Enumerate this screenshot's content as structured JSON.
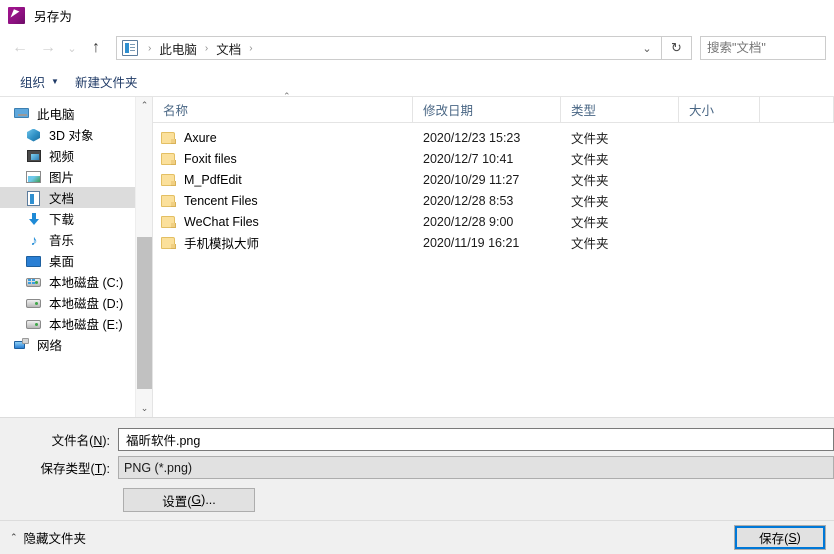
{
  "window": {
    "title": "另存为",
    "app_icon": "foxit-app-icon"
  },
  "nav": {
    "back": "←",
    "forward": "→",
    "recent": "⌄",
    "up": "↑",
    "breadcrumb": [
      "此电脑",
      "文档"
    ],
    "breadcrumb_separator": "›",
    "address_dropdown": "⌄",
    "refresh": "↻"
  },
  "search": {
    "value": "",
    "placeholder": "搜索\"文档\""
  },
  "toolbar": {
    "organize_label": "组织",
    "organize_caret": "▼",
    "new_folder_label": "新建文件夹"
  },
  "sidebar": {
    "items": [
      {
        "label": "此电脑",
        "icon": "pc-icon",
        "indent": false,
        "selected": false
      },
      {
        "label": "3D 对象",
        "icon": "3d-objects-icon",
        "indent": true,
        "selected": false
      },
      {
        "label": "视频",
        "icon": "videos-icon",
        "indent": true,
        "selected": false
      },
      {
        "label": "图片",
        "icon": "pictures-icon",
        "indent": true,
        "selected": false
      },
      {
        "label": "文档",
        "icon": "documents-icon",
        "indent": true,
        "selected": true
      },
      {
        "label": "下载",
        "icon": "downloads-icon",
        "indent": true,
        "selected": false
      },
      {
        "label": "音乐",
        "icon": "music-icon",
        "indent": true,
        "selected": false
      },
      {
        "label": "桌面",
        "icon": "desktop-icon",
        "indent": true,
        "selected": false
      },
      {
        "label": "本地磁盘 (C:)",
        "icon": "drive-system-icon",
        "indent": true,
        "selected": false
      },
      {
        "label": "本地磁盘 (D:)",
        "icon": "drive-icon",
        "indent": true,
        "selected": false
      },
      {
        "label": "本地磁盘 (E:)",
        "icon": "drive-icon",
        "indent": true,
        "selected": false
      },
      {
        "label": "网络",
        "icon": "network-icon",
        "indent": false,
        "selected": false
      }
    ],
    "scroll_up": "⌃",
    "scroll_down": "⌄"
  },
  "filelist": {
    "columns": [
      {
        "label": "名称"
      },
      {
        "label": "修改日期"
      },
      {
        "label": "类型"
      },
      {
        "label": "大小"
      }
    ],
    "sort_indicator": "⌃",
    "rows": [
      {
        "name": "Axure",
        "date": "2020/12/23 15:23",
        "type": "文件夹",
        "size": ""
      },
      {
        "name": "Foxit files",
        "date": "2020/12/7 10:41",
        "type": "文件夹",
        "size": ""
      },
      {
        "name": "M_PdfEdit",
        "date": "2020/10/29 11:27",
        "type": "文件夹",
        "size": ""
      },
      {
        "name": "Tencent Files",
        "date": "2020/12/28 8:53",
        "type": "文件夹",
        "size": ""
      },
      {
        "name": "WeChat Files",
        "date": "2020/12/28 9:00",
        "type": "文件夹",
        "size": ""
      },
      {
        "name": "手机模拟大师",
        "date": "2020/11/19 16:21",
        "type": "文件夹",
        "size": ""
      }
    ]
  },
  "form": {
    "filename_label_pre": "文件名(",
    "filename_label_key": "N",
    "filename_label_post": "):",
    "filename_value": "福昕软件.png",
    "filetype_label_pre": "保存类型(",
    "filetype_label_key": "T",
    "filetype_label_post": "):",
    "filetype_value": "PNG (*.png)",
    "settings_label_pre": "设置(",
    "settings_label_key": "G",
    "settings_label_post": ")..."
  },
  "bottom": {
    "hide_folders_label": "隐藏文件夹",
    "hide_folders_chevron": "⌃",
    "save_label_pre": "保存(",
    "save_label_key": "S",
    "save_label_post": ")"
  },
  "colors": {
    "accent": "#0078d7",
    "header_text": "#4a6785",
    "toolbar_text": "#1f3a66",
    "folder": "#fbe09b",
    "selected_row": "#dcdcdc",
    "chrome_bg": "#f0f0f0"
  }
}
